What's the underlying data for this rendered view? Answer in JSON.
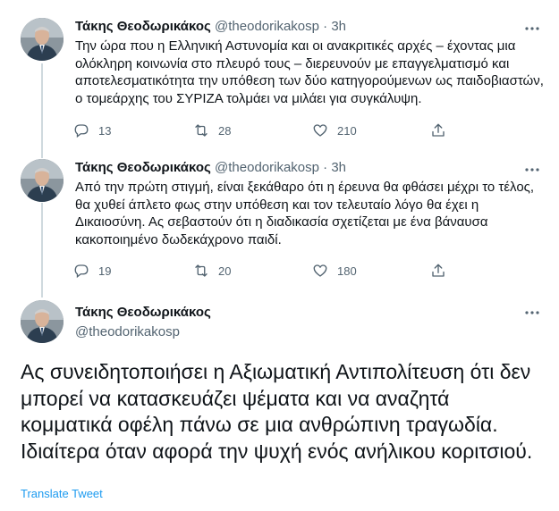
{
  "tweets": [
    {
      "name": "Τάκης Θεοδωρικάκος",
      "handle": "@theodorikakosp",
      "dot": "·",
      "time": "3h",
      "text": "Την ώρα που η Ελληνική Αστυνομία και οι ανακριτικές αρχές – έχοντας μια ολόκληρη κοινωνία στο πλευρό τους – διερευνούν με επαγγελματισμό και αποτελεσματικότητα την υπόθεση των δύο κατηγορούμενων ως παιδοβιαστών, ο τομεάρχης του ΣΥΡΙΖΑ τολμάει να μιλάει για συγκάλυψη.",
      "replies": "13",
      "retweets": "28",
      "likes": "210"
    },
    {
      "name": "Τάκης Θεοδωρικάκος",
      "handle": "@theodorikakosp",
      "dot": "·",
      "time": "3h",
      "text": "Από την πρώτη στιγμή, είναι ξεκάθαρο ότι η έρευνα θα φθάσει μέχρι το τέλος, θα χυθεί άπλετο φως στην υπόθεση και τον τελευταίο λόγο θα έχει η Δικαιοσύνη. Ας σεβαστούν ότι η διαδικασία σχετίζεται με ένα βάναυσα κακοποιημένο δωδεκάχρονο παιδί.",
      "replies": "19",
      "retweets": "20",
      "likes": "180"
    }
  ],
  "main_tweet": {
    "name": "Τάκης Θεοδωρικάκος",
    "handle": "@theodorikakosp",
    "text": "Ας συνειδητοποιήσει η Αξιωματική Αντιπολίτευση ότι δεν μπορεί να κατασκευάζει ψέματα και να αναζητά κομματικά οφέλη πάνω σε μια ανθρώπινη τραγωδία. Ιδιαίτερα όταν αφορά την ψυχή ενός ανήλικου κοριτσιού.",
    "translate_label": "Translate Tweet"
  },
  "icons": {
    "reply": "reply-icon",
    "retweet": "retweet-icon",
    "like": "heart-icon",
    "share": "share-icon",
    "more": "more-icon"
  },
  "colors": {
    "link": "#1d9bf0",
    "secondary_text": "#536471",
    "thread_line": "#cfd9de"
  }
}
